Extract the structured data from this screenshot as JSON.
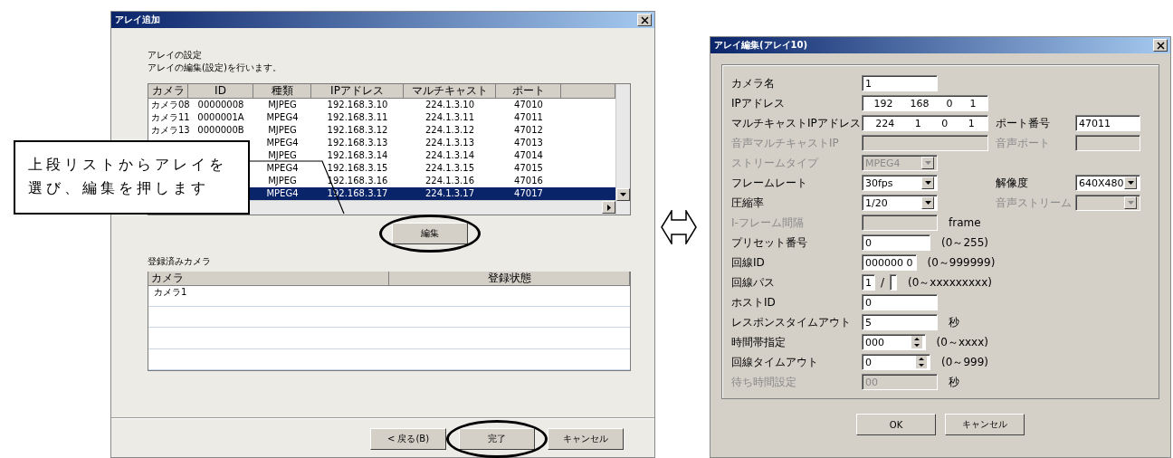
{
  "callout": {
    "text": "上段リストからアレイを選び、編集を押します"
  },
  "left_dialog": {
    "title": "アレイ追加",
    "heading": "アレイの設定",
    "description": "アレイの編集(設定)を行います。",
    "table": {
      "columns": [
        "カメラ",
        "ID",
        "種類",
        "IPアドレス",
        "マルチキャスト",
        "ポート"
      ],
      "rows": [
        {
          "cells": [
            "カメラ08",
            "00000008",
            "MJPEG",
            "192.168.3.10",
            "224.1.3.10",
            "47010"
          ],
          "selected": false
        },
        {
          "cells": [
            "カメラ11",
            "0000001A",
            "MPEG4",
            "192.168.3.11",
            "224.1.3.11",
            "47011"
          ],
          "selected": false
        },
        {
          "cells": [
            "カメラ13",
            "0000000B",
            "MJPEG",
            "192.168.3.12",
            "224.1.3.12",
            "47012"
          ],
          "selected": false
        },
        {
          "cells": [
            "MPEG4",
            "192.168.3.13",
            "224.1.3.13",
            "47013"
          ],
          "selected": false
        },
        {
          "cells": [
            "MJPEG",
            "192.168.3.14",
            "224.1.3.14",
            "47014"
          ],
          "selected": false
        },
        {
          "cells": [
            "MPEG4",
            "192.168.3.15",
            "224.1.3.15",
            "47015"
          ],
          "selected": false
        },
        {
          "cells": [
            "MJPEG",
            "192.168.3.16",
            "224.1.3.16",
            "47016"
          ],
          "selected": false
        },
        {
          "cells": [
            "MPEG4",
            "192.168.3.17",
            "224.1.3.17",
            "47017"
          ],
          "selected": true
        }
      ]
    },
    "edit_button": {
      "label": "編集",
      "highlighted": true
    },
    "registered_label": "登録済みカメラ",
    "registered_table": {
      "columns": [
        "カメラ",
        "登録状態"
      ],
      "rows": [
        {
          "cells": [
            "カメラ1"
          ]
        }
      ]
    },
    "buttons": [
      {
        "label": "< 戻る(B)",
        "highlighted": false
      },
      {
        "label": "完了",
        "highlighted": true
      },
      {
        "label": "キャンセル",
        "highlighted": false
      }
    ]
  },
  "right_dialog": {
    "title": "アレイ編集(アレイ10)",
    "rows": [
      {
        "label": "カメラ名",
        "disabled": false,
        "field": {
          "kind": "text",
          "value": "1"
        }
      },
      {
        "label": "IPアドレス",
        "disabled": false,
        "field": {
          "kind": "ip",
          "octets": [
            "192",
            "168",
            "0",
            "1"
          ]
        }
      },
      {
        "label": "マルチキャストIPアドレス",
        "disabled": false,
        "field": {
          "kind": "ip",
          "octets": [
            "224",
            "1",
            "0",
            "1"
          ]
        },
        "side": {
          "label": "ポート番号",
          "disabled": false,
          "field": {
            "kind": "text",
            "value": "47011"
          }
        }
      },
      {
        "label": "音声マルチキャストIP",
        "disabled": true,
        "field": {
          "kind": "ip"
        },
        "side": {
          "label": "音声ポート",
          "disabled": true,
          "field": {
            "kind": "text"
          }
        }
      },
      {
        "label": "ストリームタイプ",
        "disabled": true,
        "field": {
          "kind": "combo",
          "value": "MPEG4"
        }
      },
      {
        "label": "フレームレート",
        "disabled": false,
        "field": {
          "kind": "combo",
          "value": "30fps"
        },
        "side": {
          "label": "解像度",
          "disabled": false,
          "field": {
            "kind": "combo",
            "value": "640X480"
          }
        }
      },
      {
        "label": "圧縮率",
        "disabled": false,
        "field": {
          "kind": "combo",
          "value": "1/20"
        },
        "side": {
          "label": "音声ストリーム",
          "disabled": true,
          "field": {
            "kind": "combo"
          }
        }
      },
      {
        "label": "I-フレーム間隔",
        "disabled": true,
        "field": {
          "kind": "text"
        },
        "note": "frame"
      },
      {
        "label": "プリセット番号",
        "disabled": false,
        "field": {
          "kind": "text",
          "value": "0"
        },
        "note": "(0～255)"
      },
      {
        "label": "回線ID",
        "disabled": false,
        "field": {
          "kind": "text",
          "value": "000000 0"
        },
        "note": "(0～999999)"
      },
      {
        "label": "回線パス",
        "disabled": false,
        "field": {
          "kind": "pair",
          "value": "1",
          "separator": "/"
        },
        "note": "(0～xxxxxxxxx)"
      },
      {
        "label": "ホストID",
        "disabled": false,
        "field": {
          "kind": "text",
          "value": "0"
        }
      },
      {
        "label": "レスポンスタイムアウト",
        "disabled": false,
        "field": {
          "kind": "text",
          "value": "5"
        },
        "note": "秒"
      },
      {
        "label": "時間帯指定",
        "disabled": false,
        "field": {
          "kind": "spin",
          "value": "000"
        },
        "note": "(0～xxxx)"
      },
      {
        "label": "回線タイムアウト",
        "disabled": false,
        "field": {
          "kind": "spin",
          "value": "0"
        },
        "note": "(0～999)"
      },
      {
        "label": "待ち時間設定",
        "disabled": true,
        "field": {
          "kind": "text",
          "value": "00"
        },
        "note": "秒"
      }
    ],
    "buttons": [
      "OK",
      "キャンセル"
    ]
  }
}
